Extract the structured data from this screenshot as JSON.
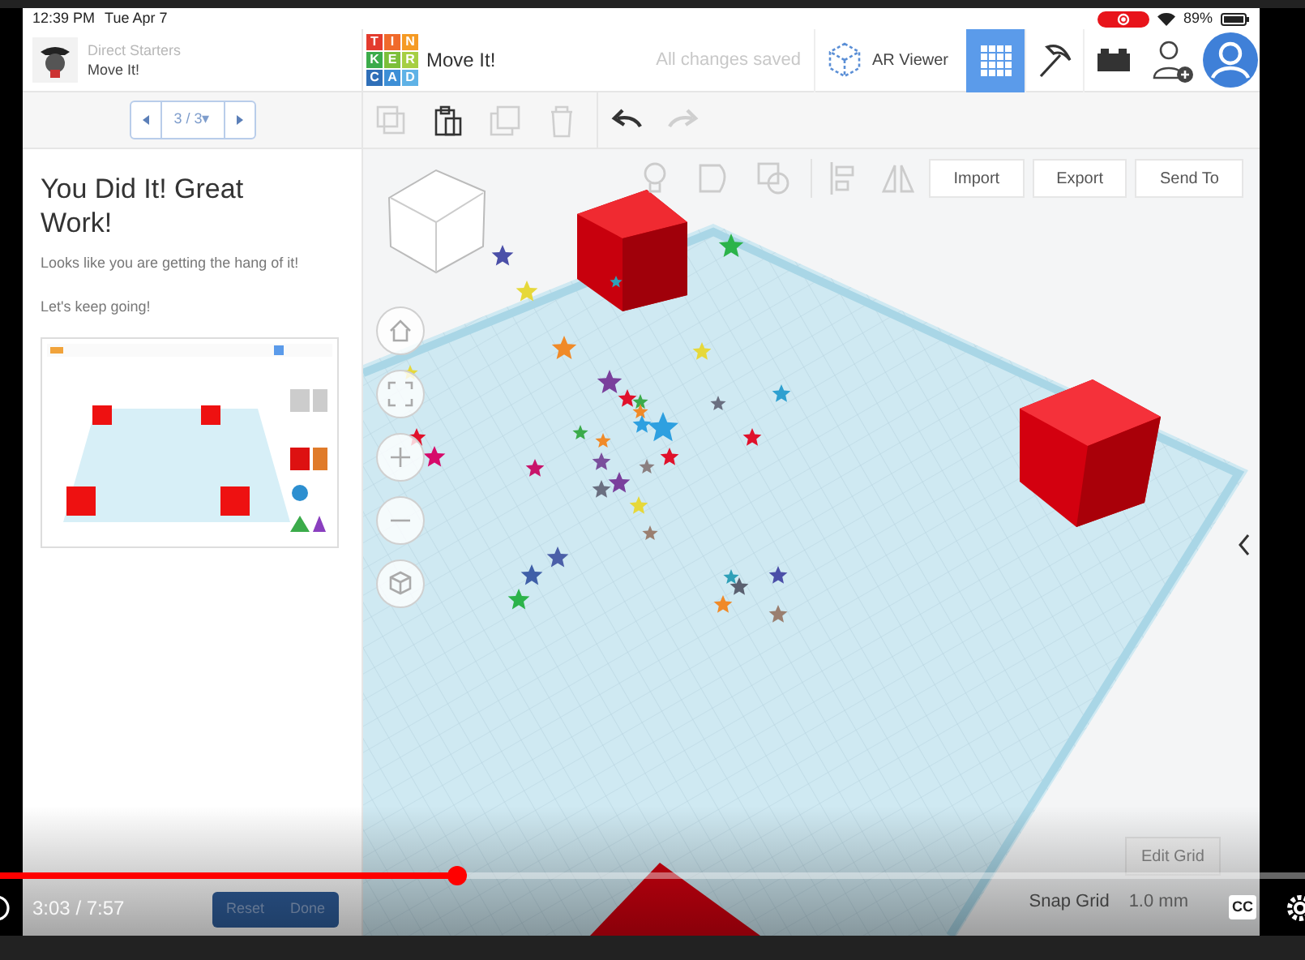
{
  "status_bar": {
    "time": "12:39 PM",
    "date": "Tue Apr 7",
    "battery": "89%"
  },
  "lesson": {
    "category": "Direct Starters",
    "title": "Move It!",
    "page": "3 / 3▾",
    "heading": "You Did It! Great Work!",
    "paragraphs": [
      "Looks like you are getting the hang of it!",
      "Let's keep going!"
    ],
    "buttons": [
      "Reset",
      "Done"
    ]
  },
  "app": {
    "logo_letters": [
      "T",
      "I",
      "N",
      "K",
      "E",
      "R",
      "C",
      "A",
      "D"
    ],
    "design_title": "Move It!",
    "save_status": "All changes saved",
    "ar_viewer": "AR Viewer",
    "views": [
      {
        "kind": "grid",
        "selected": true
      },
      {
        "kind": "pickaxe",
        "selected": false
      },
      {
        "kind": "bricks",
        "selected": false
      }
    ],
    "edit_tools": [
      {
        "kind": "copy",
        "disabled": true
      },
      {
        "kind": "paste",
        "disabled": false
      },
      {
        "kind": "duplicate",
        "disabled": true
      },
      {
        "kind": "delete",
        "disabled": true
      },
      {
        "kind": "undo",
        "disabled": false
      },
      {
        "kind": "redo",
        "disabled": true
      }
    ],
    "actions": [
      "Import",
      "Export",
      "Send To"
    ],
    "edit_grid": "Edit Grid",
    "snap_grid": {
      "label": "Snap Grid",
      "value": "1.0 mm"
    }
  },
  "video": {
    "time": "3:03 / 7:57",
    "level": 0.35,
    "cc": "CC"
  }
}
